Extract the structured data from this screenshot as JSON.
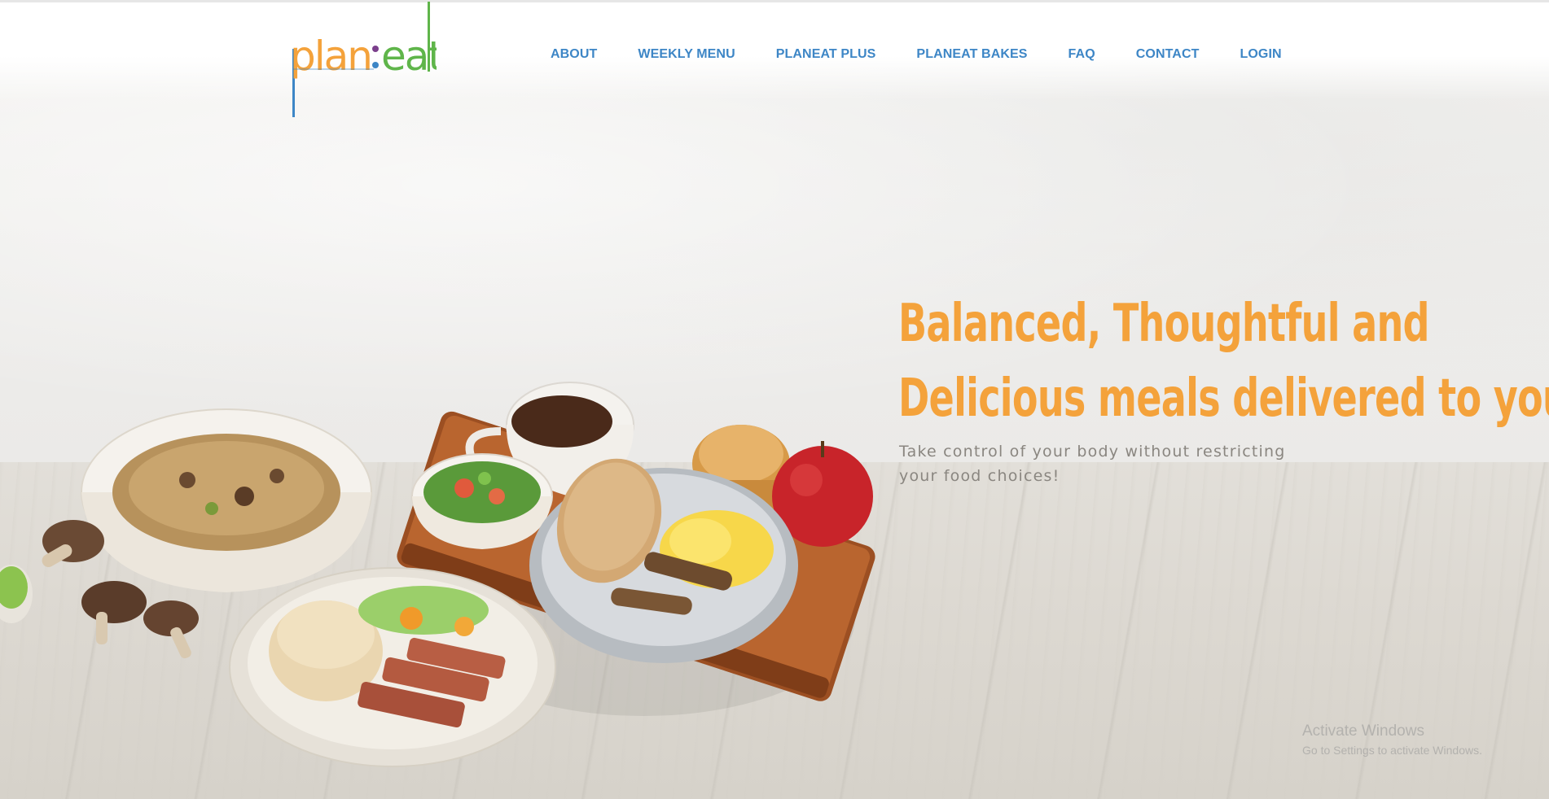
{
  "brand": {
    "logo_text": "plan:eat",
    "colors": {
      "orange": "#f4a23b",
      "blue": "#3d86c6",
      "green": "#5fb54a",
      "purple": "#7b3f8c"
    }
  },
  "nav": {
    "items": [
      {
        "label": "ABOUT"
      },
      {
        "label": "WEEKLY MENU"
      },
      {
        "label": "PLANEAT PLUS"
      },
      {
        "label": "PLANEAT BAKES"
      },
      {
        "label": "FAQ"
      },
      {
        "label": "CONTACT"
      },
      {
        "label": "LOGIN"
      }
    ]
  },
  "hero": {
    "title_line1": "Balanced, Thoughtful and",
    "title_line2": "Delicious meals delivered to you!",
    "subtitle": "Take control of your body without restricting your food choices!"
  },
  "os_watermark": {
    "title": "Activate Windows",
    "subtitle": "Go to Settings to activate Windows."
  }
}
